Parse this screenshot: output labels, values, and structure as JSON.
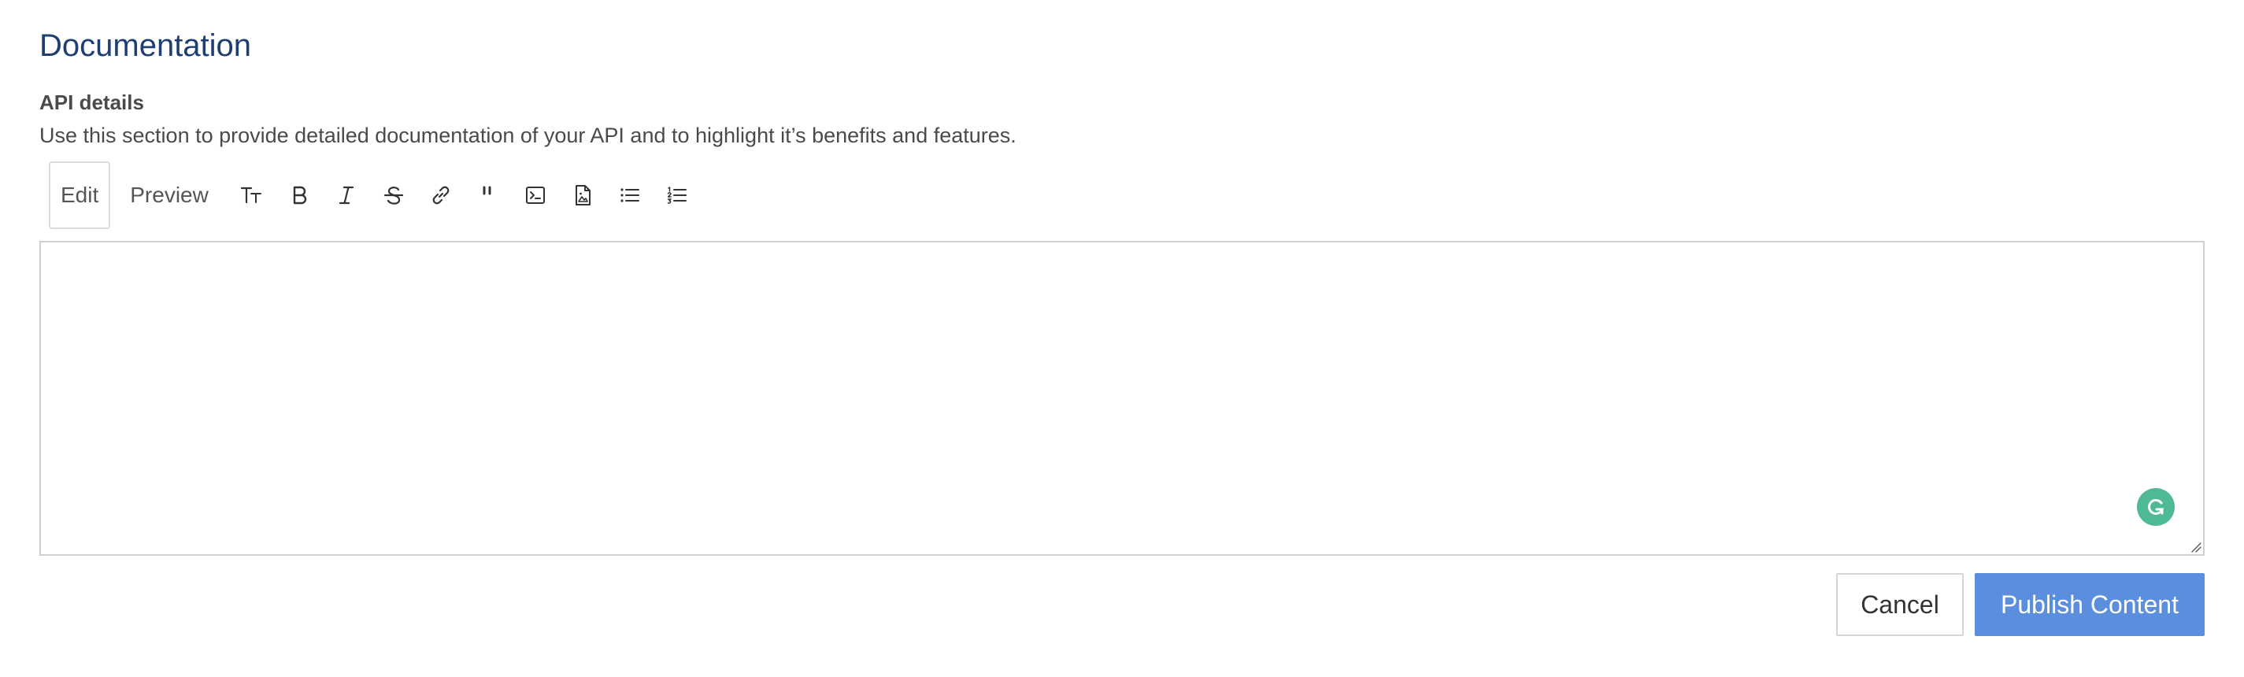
{
  "section": {
    "title": "Documentation"
  },
  "field": {
    "label": "API details",
    "help": "Use this section to provide detailed documentation of your API and to highlight it’s benefits and features."
  },
  "tabs": {
    "edit": "Edit",
    "preview": "Preview"
  },
  "toolbar_icons": [
    "text-size-icon",
    "bold-icon",
    "italic-icon",
    "strikethrough-icon",
    "link-icon",
    "quote-icon",
    "code-icon",
    "image-icon",
    "bulleted-list-icon",
    "numbered-list-icon"
  ],
  "editor": {
    "value": ""
  },
  "actions": {
    "cancel": "Cancel",
    "publish": "Publish Content"
  },
  "colors": {
    "title": "#1f3f73",
    "primary_button": "#5b8fde",
    "grammarly": "#4fb895"
  }
}
